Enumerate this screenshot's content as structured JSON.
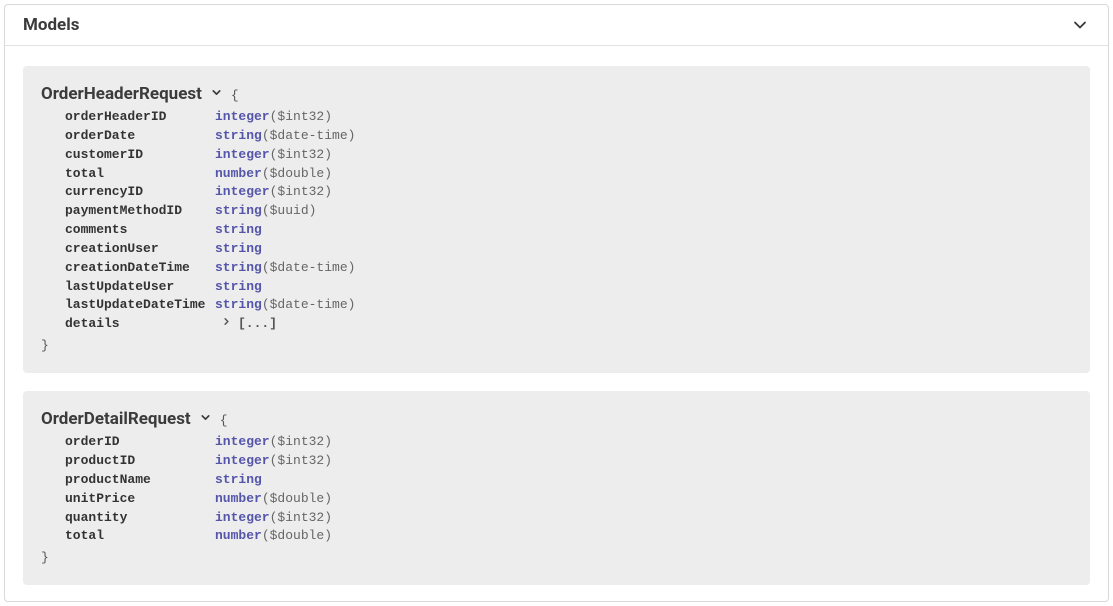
{
  "panel": {
    "title": "Models"
  },
  "models": [
    {
      "name": "OrderHeaderRequest",
      "open_brace": "{",
      "close_brace": "}",
      "expand_label": "[...]",
      "props": [
        {
          "name": "orderHeaderID",
          "type": "integer",
          "format": "($int32)"
        },
        {
          "name": "orderDate",
          "type": "string",
          "format": "($date-time)"
        },
        {
          "name": "customerID",
          "type": "integer",
          "format": "($int32)"
        },
        {
          "name": "total",
          "type": "number",
          "format": "($double)"
        },
        {
          "name": "currencyID",
          "type": "integer",
          "format": "($int32)"
        },
        {
          "name": "paymentMethodID",
          "type": "string",
          "format": "($uuid)"
        },
        {
          "name": "comments",
          "type": "string",
          "format": ""
        },
        {
          "name": "creationUser",
          "type": "string",
          "format": ""
        },
        {
          "name": "creationDateTime",
          "type": "string",
          "format": "($date-time)"
        },
        {
          "name": "lastUpdateUser",
          "type": "string",
          "format": ""
        },
        {
          "name": "lastUpdateDateTime",
          "type": "string",
          "format": "($date-time)"
        },
        {
          "name": "details",
          "type": "",
          "format": "",
          "expandable": true
        }
      ]
    },
    {
      "name": "OrderDetailRequest",
      "open_brace": "{",
      "close_brace": "}",
      "props": [
        {
          "name": "orderID",
          "type": "integer",
          "format": "($int32)"
        },
        {
          "name": "productID",
          "type": "integer",
          "format": "($int32)"
        },
        {
          "name": "productName",
          "type": "string",
          "format": ""
        },
        {
          "name": "unitPrice",
          "type": "number",
          "format": "($double)"
        },
        {
          "name": "quantity",
          "type": "integer",
          "format": "($int32)"
        },
        {
          "name": "total",
          "type": "number",
          "format": "($double)"
        }
      ]
    }
  ]
}
